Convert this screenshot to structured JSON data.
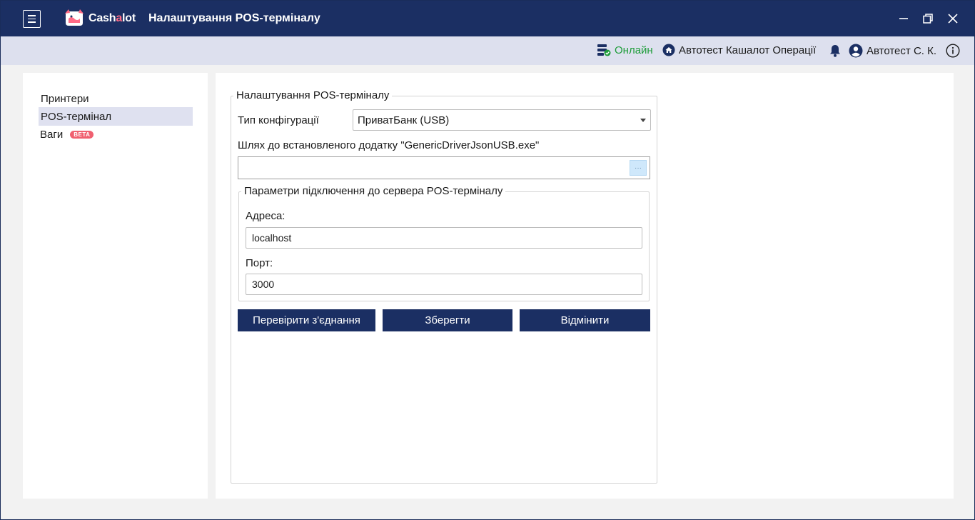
{
  "titlebar": {
    "menu_icon": "hamburger-menu-icon",
    "brand_prefix": "Cash",
    "brand_accent": "a",
    "brand_suffix": "lot",
    "title": "Налаштування POS-терміналу",
    "colors": {
      "bar": "#1b2f63",
      "accent": "#ff6b86"
    }
  },
  "status": {
    "online_label": "Онлайн",
    "online_icon": "server-check-icon",
    "company_icon": "home-icon",
    "company": "Автотест Кашалот Операції",
    "bell_icon": "bell-icon",
    "user_icon": "user-circle-icon",
    "user": "Автотест С. К.",
    "info_icon": "info-icon",
    "colors": {
      "online": "#1f9d3b",
      "bar": "#dde0ee"
    }
  },
  "nav": {
    "items": [
      {
        "label": "Принтери",
        "active": false
      },
      {
        "label": "POS-термінал",
        "active": true
      },
      {
        "label": "Ваги",
        "active": false,
        "badge": "BETA"
      }
    ]
  },
  "form": {
    "legend": "Налаштування POS-терміналу",
    "config_type_label": "Тип конфігурації",
    "config_type_value": "ПриватБанк (USB)",
    "path_label": "Шлях до встановленого додатку \"GenericDriverJsonUSB.exe\"",
    "path_value": "",
    "browse_label": "···",
    "server": {
      "legend": "Параметри підключення до сервера POS-терміналу",
      "address_label": "Адреса:",
      "address_value": "localhost",
      "port_label": "Порт:",
      "port_value": "3000"
    },
    "buttons": {
      "check": "Перевірити з'єднання",
      "save": "Зберегти",
      "cancel": "Відмінити"
    }
  }
}
